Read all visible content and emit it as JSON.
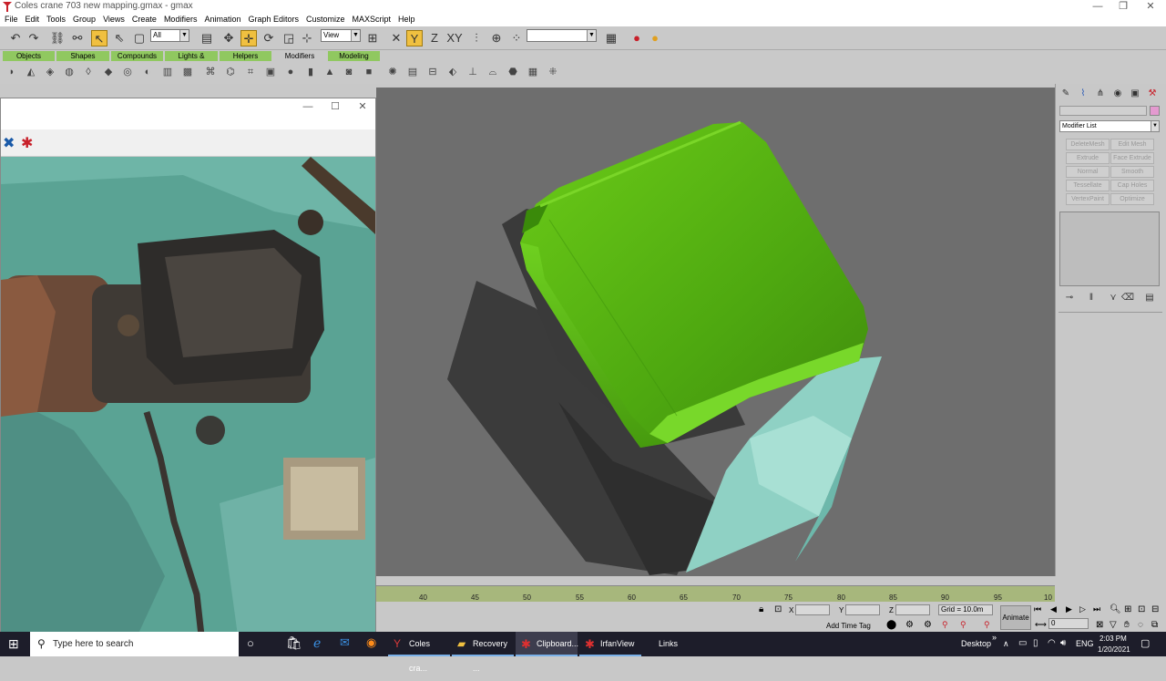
{
  "window": {
    "title": "Coles crane 703 new mapping.gmax - gmax",
    "controls": [
      "—",
      "❐",
      "✕"
    ]
  },
  "menu": [
    "File",
    "Edit",
    "Tools",
    "Group",
    "Views",
    "Create",
    "Modifiers",
    "Animation",
    "Graph Editors",
    "Customize",
    "MAXScript",
    "Help"
  ],
  "toolbar": {
    "selection_filter": "All",
    "reference_coord": "View"
  },
  "tabs": [
    "Objects",
    "Shapes",
    "Compounds",
    "Lights & Cameras",
    "Helpers",
    "Modifiers",
    "Modeling"
  ],
  "active_tab": "Modifiers",
  "image_window": {
    "controls": [
      "—",
      "☐",
      "✕"
    ]
  },
  "command_panel": {
    "modifier_list": "Modifier List",
    "modifier_buttons": [
      "DeleteMesh",
      "Edit Mesh",
      "Extrude",
      "Face Extrude",
      "Normal",
      "Smooth",
      "Tessellate",
      "Cap Holes",
      "VertexPaint",
      "Optimize"
    ]
  },
  "timeline": {
    "ticks": [
      "40",
      "45",
      "50",
      "55",
      "60",
      "65",
      "70",
      "75",
      "80",
      "85",
      "90",
      "95",
      "10"
    ]
  },
  "status": {
    "x_label": "X",
    "y_label": "Y",
    "z_label": "Z",
    "grid": "Grid = 10.0m",
    "add_time_tag": "Add Time Tag",
    "animate": "Animate",
    "frame": "0"
  },
  "taskbar": {
    "search_placeholder": "Type here to search",
    "apps": [
      "Coles cra...",
      "Recovery ...",
      "Clipboard...",
      "IrfanView"
    ],
    "links": "Links",
    "desktop": "Desktop",
    "language": "ENG",
    "time": "2:03 PM",
    "date": "1/20/2021"
  },
  "colors": {
    "green_object": "#5cb010",
    "grey_object": "#3b3b3b",
    "teal_object": "#8fd1c4",
    "viewport_bg": "#6e6e6e",
    "tab_green": "#90c860"
  }
}
